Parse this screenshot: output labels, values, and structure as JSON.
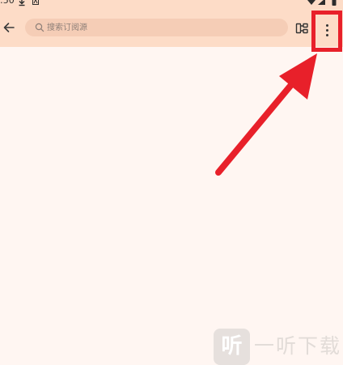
{
  "status_bar": {
    "time": ":50",
    "download_icon": "download-icon",
    "notification_icon": "a-icon",
    "wifi_icon": "wifi-icon",
    "signal_icon": "signal-icon",
    "battery_icon": "battery-icon"
  },
  "top_bar": {
    "back_icon": "arrow-left-icon",
    "search": {
      "placeholder": "搜索订阅源",
      "value": ""
    },
    "group_icon": "group-icon",
    "more_icon": "more-vertical-icon"
  },
  "annotation": {
    "highlight_color": "#E8202A"
  },
  "watermark": {
    "logo_text": "听",
    "text": "一听下载"
  },
  "colors": {
    "top_bar_background": "#FDDCC7",
    "page_background": "#FFF6F2",
    "search_background": "#F5CDB6",
    "placeholder_text": "#8E7F78",
    "highlight": "#E8202A"
  }
}
